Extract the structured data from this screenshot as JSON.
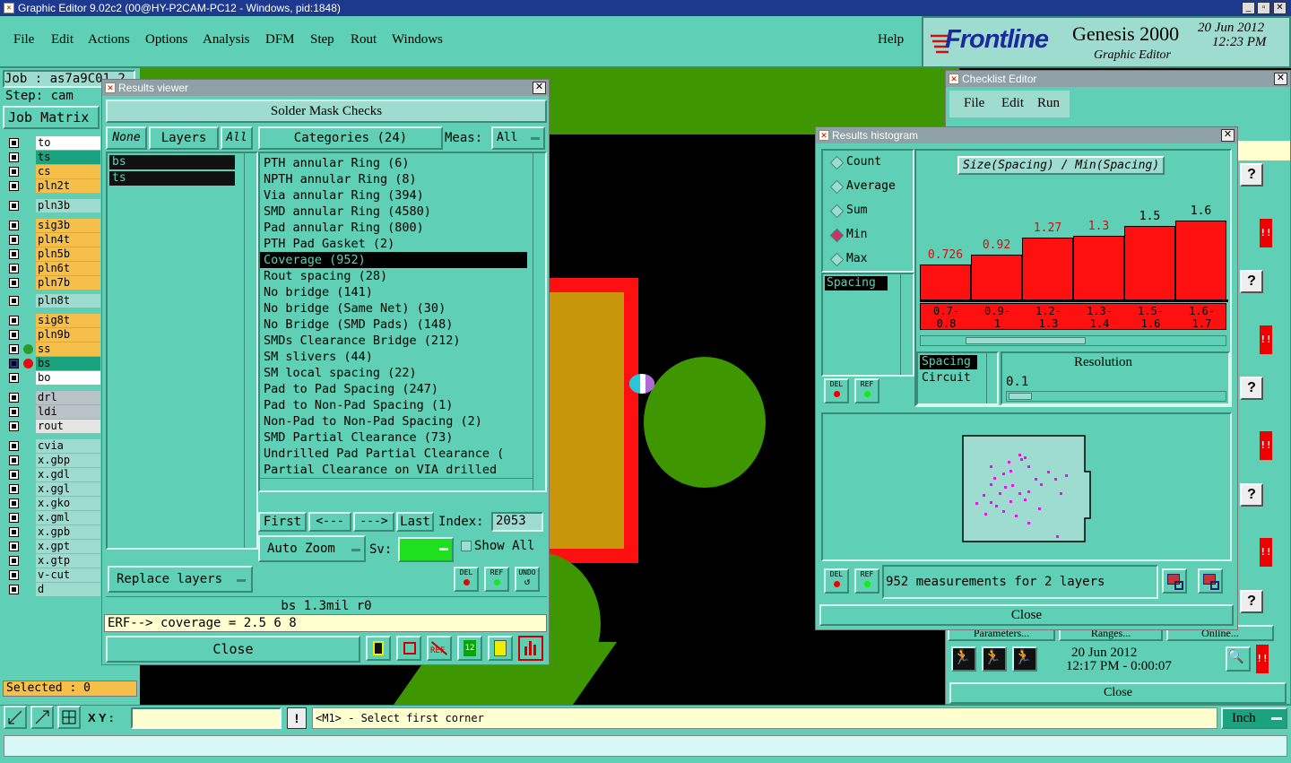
{
  "app": {
    "title": "Graphic Editor 9.02c2 (00@HY-P2CAM-PC12 - Windows, pid:1848)",
    "menu": [
      "File",
      "Edit",
      "Actions",
      "Options",
      "Analysis",
      "DFM",
      "Step",
      "Rout",
      "Windows"
    ],
    "help": "Help",
    "brand": "Frontline",
    "product": "Genesis 2000",
    "subtitle": "Graphic Editor",
    "date": "20 Jun 2012",
    "time": "12:23 PM"
  },
  "left_panel": {
    "job": "Job : as7a9C01 2",
    "step": "Step: cam",
    "job_matrix": "Job Matrix",
    "layers": [
      {
        "name": "to",
        "color": "#ffffff"
      },
      {
        "name": "ts",
        "color": "#1aa37f"
      },
      {
        "name": "cs",
        "color": "#f5bf4a"
      },
      {
        "name": "pln2t",
        "color": "#f5bf4a"
      },
      {
        "name": "pln3b",
        "color": "#9fdcd0"
      },
      {
        "name": "sig3b",
        "color": "#f5bf4a"
      },
      {
        "name": "pln4t",
        "color": "#f5bf4a"
      },
      {
        "name": "pln5b",
        "color": "#f5bf4a"
      },
      {
        "name": "pln6t",
        "color": "#f5bf4a"
      },
      {
        "name": "pln7b",
        "color": "#f5bf4a"
      },
      {
        "name": "pln8t",
        "color": "#9fdcd0"
      },
      {
        "name": "sig8t",
        "color": "#f5bf4a"
      },
      {
        "name": "pln9b",
        "color": "#f5bf4a"
      },
      {
        "name": "ss",
        "color": "#f5bf4a"
      },
      {
        "name": "bs",
        "color": "#1aa37f"
      },
      {
        "name": "bo",
        "color": "#ffffff"
      },
      {
        "name": "drl",
        "color": "#b9c2c6"
      },
      {
        "name": "ldi",
        "color": "#b9c2c6"
      },
      {
        "name": "rout",
        "color": "#e4e4e4"
      },
      {
        "name": "cvia",
        "color": "#9fdcd0"
      },
      {
        "name": "x.gbp",
        "color": "#9fdcd0"
      },
      {
        "name": "x.gdl",
        "color": "#9fdcd0"
      },
      {
        "name": "x.ggl",
        "color": "#9fdcd0"
      },
      {
        "name": "x.gko",
        "color": "#9fdcd0"
      },
      {
        "name": "x.gml",
        "color": "#9fdcd0"
      },
      {
        "name": "x.gpb",
        "color": "#9fdcd0"
      },
      {
        "name": "x.gpt",
        "color": "#9fdcd0"
      },
      {
        "name": "x.gtp",
        "color": "#9fdcd0"
      },
      {
        "name": "v-cut",
        "color": "#9fdcd0"
      },
      {
        "name": "d",
        "color": "#9fdcd0"
      }
    ],
    "selected": "Selected : 0"
  },
  "results_viewer": {
    "title": "Results viewer",
    "header": "Solder Mask Checks",
    "none_btn": "None",
    "layers_btn": "Layers",
    "all_btn": "All",
    "layer_list": [
      "bs",
      "ts"
    ],
    "categories_btn": "Categories (24)",
    "meas_label": "Meas:",
    "meas_value": "All",
    "categories": [
      "PTH annular Ring (6)",
      "NPTH annular Ring (8)",
      "Via annular Ring (394)",
      "SMD annular Ring (4580)",
      "Pad annular Ring (800)",
      "PTH Pad Gasket (2)",
      "Coverage (952)",
      "Rout spacing (28)",
      "No bridge (141)",
      "No bridge (Same Net) (30)",
      "No Bridge (SMD Pads) (148)",
      "SMDs Clearance Bridge (212)",
      "SM slivers (44)",
      "SM local spacing (22)",
      "Pad to Pad Spacing (247)",
      "Pad to Non-Pad Spacing (1)",
      "Non-Pad to Non-Pad Spacing (2)",
      "SMD Partial Clearance (73)",
      "Undrilled Pad Partial Clearance (",
      "Partial Clearance on VIA drilled"
    ],
    "selected_category": "Coverage (952)",
    "first": "First",
    "prev": "<---",
    "next": "--->",
    "last": "Last",
    "index_label": "Index:",
    "index_value": "2053",
    "auto_zoom": "Auto Zoom",
    "sv_label": "Sv:",
    "show_all": "Show All",
    "replace_layers": "Replace layers",
    "del": "DEL",
    "ref": "REF",
    "undo": "UNDO",
    "status": "bs 1.3mil  r0",
    "erf": "ERF--> coverage = 2.5 6 8",
    "close": "Close"
  },
  "histogram": {
    "title": "Results histogram",
    "modes": [
      "Count",
      "Average",
      "Sum",
      "Min",
      "Max"
    ],
    "selected_mode": "Min",
    "measure_list": [
      "Spacing"
    ],
    "chart_title": "Size(Spacing) / Min(Spacing)",
    "resolution_label": "Resolution",
    "resolution_value": "0.1",
    "attr_list": [
      "Spacing",
      "Circuit"
    ],
    "measurements": "952 measurements for 2 layers",
    "close": "Close",
    "del": "DEL",
    "ref": "REF"
  },
  "chart_data": {
    "type": "bar",
    "title": "Size(Spacing) / Min(Spacing)",
    "categories": [
      "0.7-0.8",
      "0.9-1",
      "1.2-1.3",
      "1.3-1.4",
      "1.5-1.6",
      "1.6-1.7"
    ],
    "category_lines": [
      [
        "0.7-",
        "0.8"
      ],
      [
        "0.9-",
        "1"
      ],
      [
        "1.2-",
        "1.3"
      ],
      [
        "1.3-",
        "1.4"
      ],
      [
        "1.5-",
        "1.6"
      ],
      [
        "1.6-",
        "1.7"
      ]
    ],
    "values": [
      0.726,
      0.92,
      1.27,
      1.3,
      1.5,
      1.6
    ],
    "value_labels": [
      "0.726",
      "0.92",
      "1.27",
      "1.3",
      "1.5",
      "1.6"
    ],
    "value_label_colors": [
      "#d01010",
      "#d01010",
      "#d01010",
      "#d01010",
      "#000000",
      "#000000"
    ],
    "bar_color": "#ff1010",
    "ylim": [
      0,
      1.6
    ]
  },
  "checklist": {
    "title": "Checklist Editor",
    "menu": [
      "File",
      "Edit",
      "Run"
    ],
    "parameters": "Parameters...",
    "ranges": "Ranges...",
    "online": "Online...",
    "date": "20 Jun 2012",
    "time": "12:17 PM - 0:00:07",
    "close": "Close",
    "q": "?",
    "mark": "!!"
  },
  "bottom": {
    "xy_label": "X Y :",
    "bang": "!",
    "prompt": "<M1> - Select first corner",
    "units": "Inch"
  }
}
